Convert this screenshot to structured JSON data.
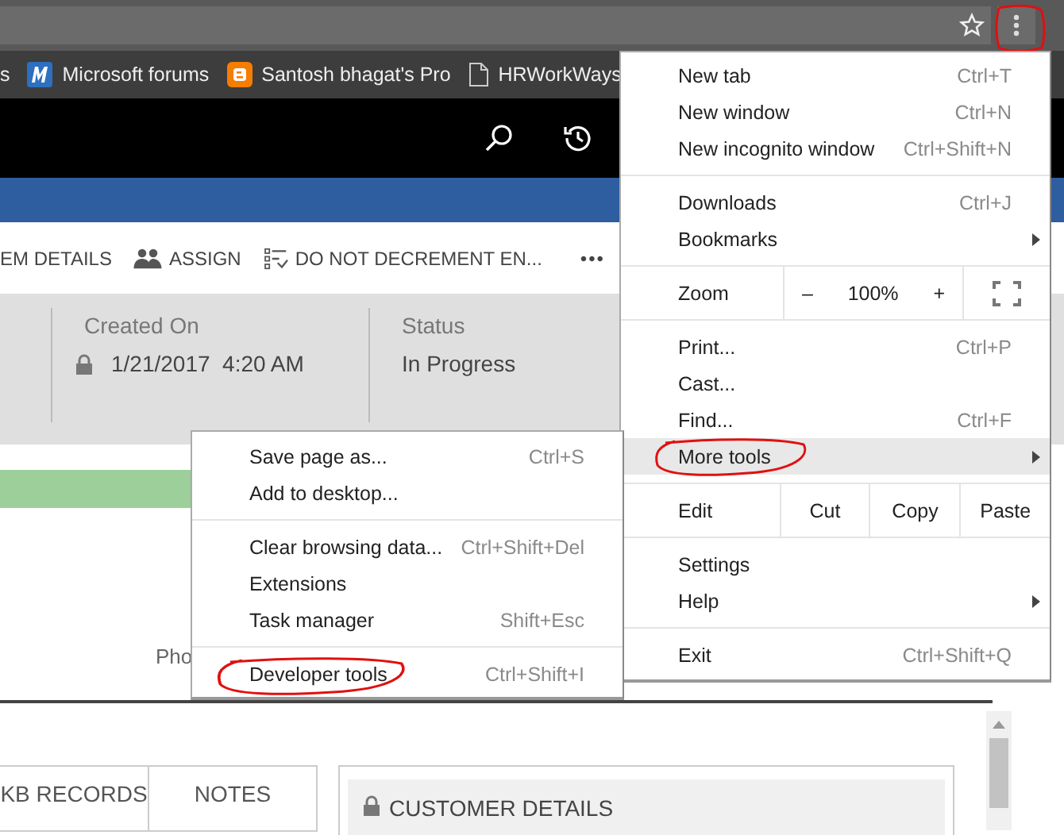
{
  "toolbar": {
    "menu_button_annotated": true
  },
  "bookmarks": [
    {
      "kind": "cut",
      "label": "s"
    },
    {
      "kind": "ms",
      "label": "Microsoft forums"
    },
    {
      "kind": "blogger",
      "label": "Santosh bhagat's Pro"
    },
    {
      "kind": "page",
      "label": "HRWorkWays"
    }
  ],
  "command_bar": [
    {
      "kind": "text",
      "label": "EM DETAILS"
    },
    {
      "kind": "assign",
      "label": "ASSIGN"
    },
    {
      "kind": "checklist",
      "label": "DO NOT DECREMENT EN..."
    },
    {
      "kind": "more",
      "label": "•••"
    }
  ],
  "header_fields": [
    {
      "label": "Created On",
      "value": "1/21/2017  4:20 AM",
      "locked": true
    },
    {
      "label": "Status",
      "value": "In Progress",
      "locked": false
    }
  ],
  "form_label": "Pho",
  "tabs": [
    {
      "label": "KB RECORDS"
    },
    {
      "label": "NOTES"
    }
  ],
  "section": {
    "title": "CUSTOMER DETAILS",
    "locked": true
  },
  "menu": [
    {
      "kind": "item",
      "label": "New tab",
      "shortcut": "Ctrl+T",
      "submenu": false,
      "selected": false,
      "circled": false
    },
    {
      "kind": "item",
      "label": "New window",
      "shortcut": "Ctrl+N",
      "submenu": false,
      "selected": false,
      "circled": false
    },
    {
      "kind": "item",
      "label": "New incognito window",
      "shortcut": "Ctrl+Shift+N",
      "submenu": false,
      "selected": false,
      "circled": false
    },
    {
      "kind": "separator"
    },
    {
      "kind": "item",
      "label": "Downloads",
      "shortcut": "Ctrl+J",
      "submenu": false,
      "selected": false,
      "circled": false
    },
    {
      "kind": "item",
      "label": "Bookmarks",
      "submenu": true,
      "selected": false,
      "circled": false
    },
    {
      "kind": "separator"
    },
    {
      "kind": "zoom",
      "label": "Zoom",
      "minus": "–",
      "value": "100%",
      "plus": "+"
    },
    {
      "kind": "separator"
    },
    {
      "kind": "item",
      "label": "Print...",
      "shortcut": "Ctrl+P",
      "submenu": false,
      "selected": false,
      "circled": false
    },
    {
      "kind": "item",
      "label": "Cast...",
      "submenu": false,
      "selected": false,
      "circled": false
    },
    {
      "kind": "item",
      "label": "Find...",
      "shortcut": "Ctrl+F",
      "submenu": false,
      "selected": false,
      "circled": false
    },
    {
      "kind": "item",
      "label": "More tools",
      "submenu": true,
      "selected": true,
      "circled": true
    },
    {
      "kind": "separator"
    },
    {
      "kind": "edit",
      "label": "Edit",
      "actions": [
        "Cut",
        "Copy",
        "Paste"
      ]
    },
    {
      "kind": "separator"
    },
    {
      "kind": "item",
      "label": "Settings",
      "submenu": false,
      "selected": false,
      "circled": false
    },
    {
      "kind": "item",
      "label": "Help",
      "submenu": true,
      "selected": false,
      "circled": false
    },
    {
      "kind": "separator"
    },
    {
      "kind": "item",
      "label": "Exit",
      "shortcut": "Ctrl+Shift+Q",
      "submenu": false,
      "selected": false,
      "circled": false
    }
  ],
  "submenu": [
    {
      "kind": "item",
      "label": "Save page as...",
      "shortcut": "Ctrl+S",
      "selected": false,
      "circled": false
    },
    {
      "kind": "item",
      "label": "Add to desktop...",
      "selected": false,
      "circled": false
    },
    {
      "kind": "separator"
    },
    {
      "kind": "item",
      "label": "Clear browsing data...",
      "shortcut": "Ctrl+Shift+Del",
      "selected": false,
      "circled": false
    },
    {
      "kind": "item",
      "label": "Extensions",
      "selected": false,
      "circled": false
    },
    {
      "kind": "item",
      "label": "Task manager",
      "shortcut": "Shift+Esc",
      "selected": false,
      "circled": false
    },
    {
      "kind": "separator"
    },
    {
      "kind": "item",
      "label": "Developer tools",
      "shortcut": "Ctrl+Shift+I",
      "selected": false,
      "circled": true
    }
  ]
}
